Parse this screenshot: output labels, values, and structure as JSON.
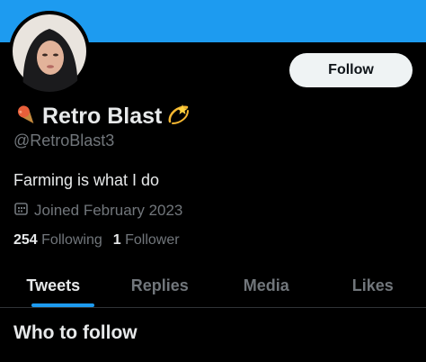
{
  "profile": {
    "display_name": "Retro Blast",
    "handle": "@RetroBlast3",
    "bio": "Farming is what I do",
    "joined": "Joined February 2023",
    "following_count": "254",
    "following_label": "Following",
    "followers_count": "1",
    "followers_label": "Follower",
    "follow_button": "Follow",
    "name_emoji_left": "ice-cream-icon",
    "name_emoji_right": "dizzy-star-icon"
  },
  "tabs": [
    {
      "label": "Tweets",
      "active": true
    },
    {
      "label": "Replies",
      "active": false
    },
    {
      "label": "Media",
      "active": false
    },
    {
      "label": "Likes",
      "active": false
    }
  ],
  "sections": {
    "who_to_follow": "Who to follow"
  },
  "colors": {
    "banner": "#1d9bf0",
    "accent": "#1d9bf0",
    "background": "#000000",
    "secondary_text": "#71767b"
  }
}
